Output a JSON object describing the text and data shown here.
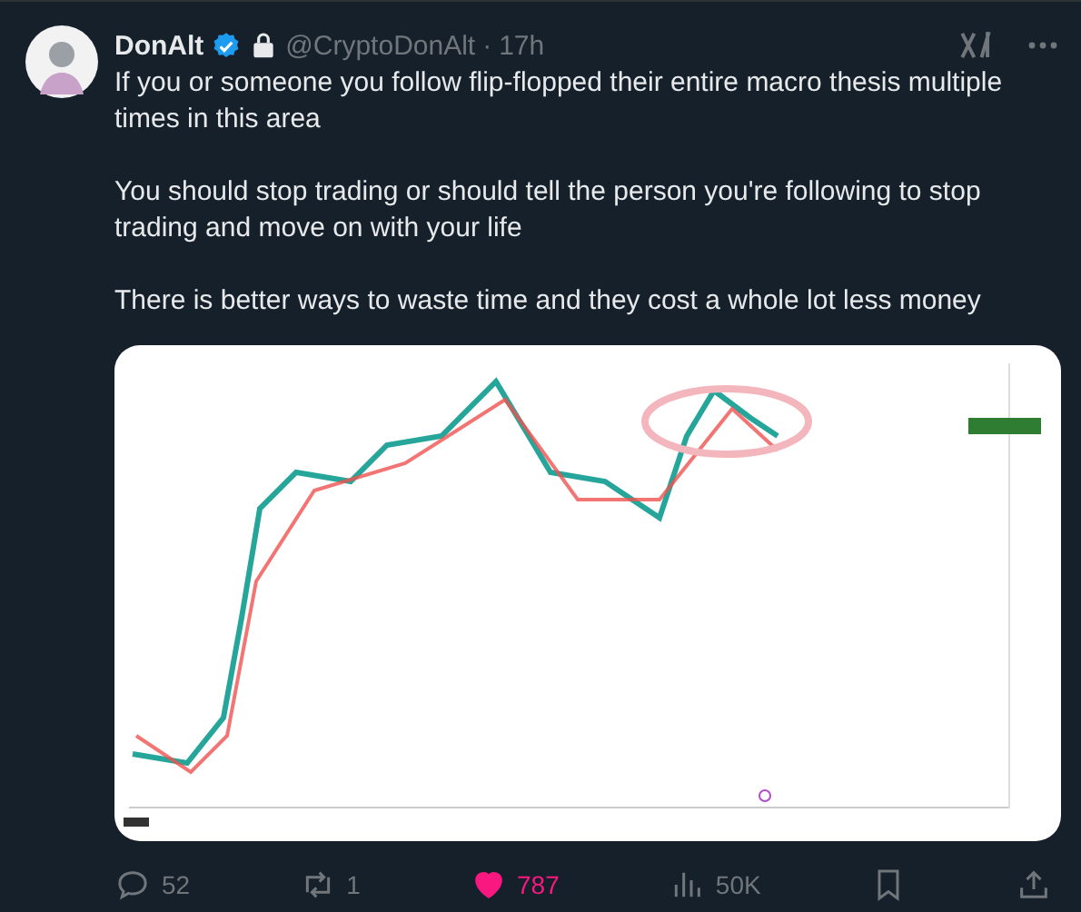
{
  "author": {
    "name": "DonAlt",
    "verified": true,
    "protected": true,
    "handle": "@CryptoDonAlt",
    "separator": "·",
    "time": "17h"
  },
  "text": [
    "If you or someone you follow flip-flopped their entire macro thesis multiple times in this area",
    "You should stop trading or should tell the person you're following to stop trading and move on with your life",
    "There is better ways to waste time and they cost a whole lot less money"
  ],
  "actions": [
    {
      "kind": "reply",
      "count": "52",
      "active": false
    },
    {
      "kind": "repost",
      "count": "1",
      "active": false
    },
    {
      "kind": "like",
      "count": "787",
      "active": true
    },
    {
      "kind": "views",
      "count": "50K",
      "active": false
    },
    {
      "kind": "bookmark",
      "active": false
    },
    {
      "kind": "share",
      "active": false
    }
  ]
}
